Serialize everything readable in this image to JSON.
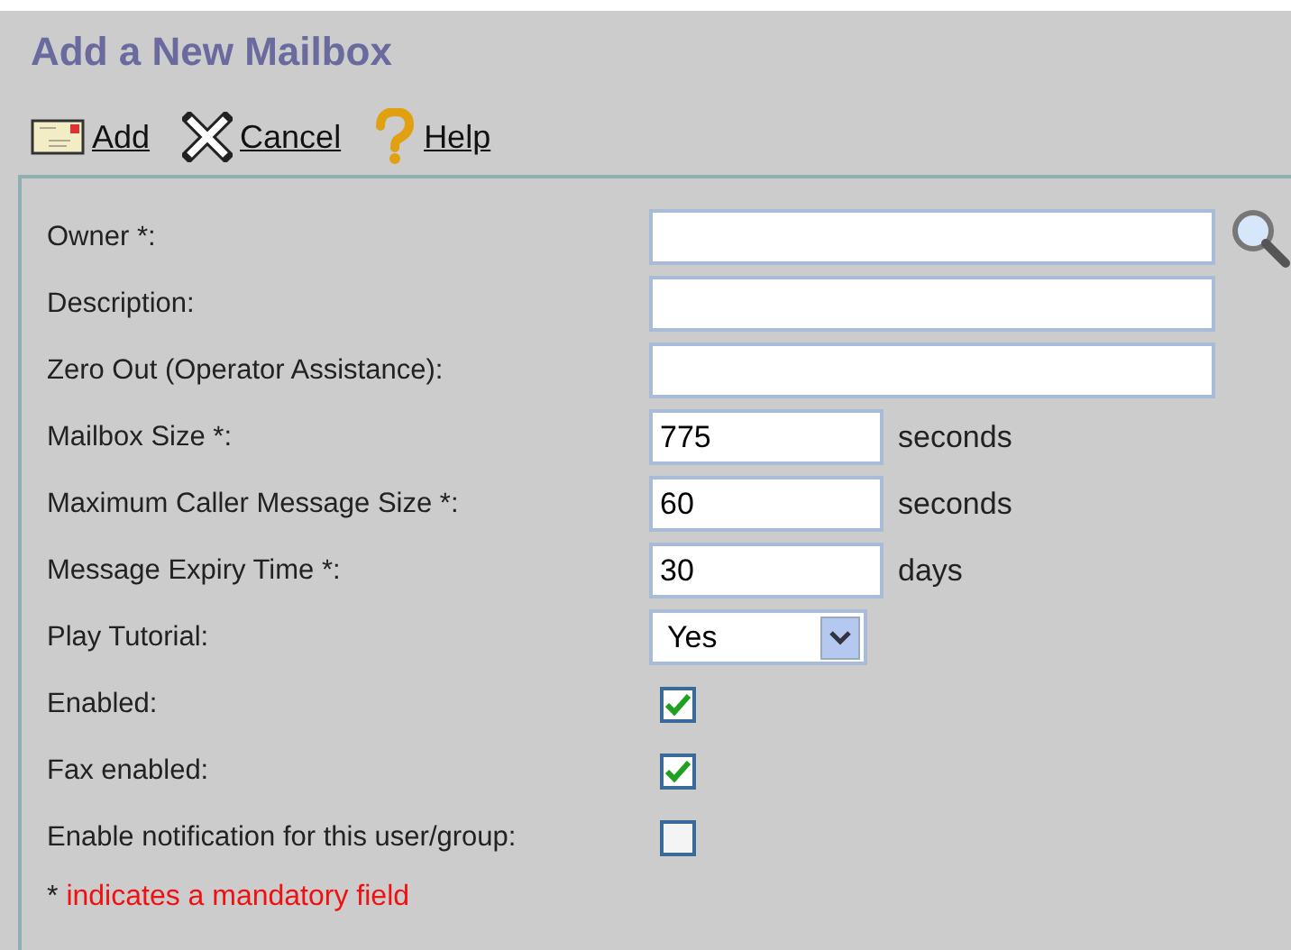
{
  "title": "Add a New Mailbox",
  "toolbar": [
    {
      "label": "Add",
      "kind": "add"
    },
    {
      "label": "Cancel",
      "kind": "cancel"
    },
    {
      "label": "Help",
      "kind": "help"
    }
  ],
  "fields": [
    {
      "label": "Owner *:",
      "kind": "lookup"
    },
    {
      "label": "Description:",
      "kind": "text"
    },
    {
      "label": "Zero Out (Operator Assistance):",
      "kind": "text"
    },
    {
      "label": "Mailbox Size *:",
      "kind": "number",
      "value": "775",
      "unit": "seconds"
    },
    {
      "label": "Maximum Caller Message Size *:",
      "kind": "number",
      "value": "60",
      "unit": "seconds"
    },
    {
      "label": "Message Expiry Time *:",
      "kind": "number",
      "value": "30",
      "unit": "days"
    },
    {
      "label": "Play Tutorial:",
      "kind": "select",
      "value": "Yes"
    },
    {
      "label": "Enabled:",
      "kind": "checkbox",
      "checked": true
    },
    {
      "label": "Fax enabled:",
      "kind": "checkbox",
      "checked": true
    },
    {
      "label": "Enable notification for this user/group:",
      "kind": "checkbox",
      "checked": false
    }
  ],
  "note": {
    "mark": "*",
    "text": "indicates a mandatory field"
  }
}
